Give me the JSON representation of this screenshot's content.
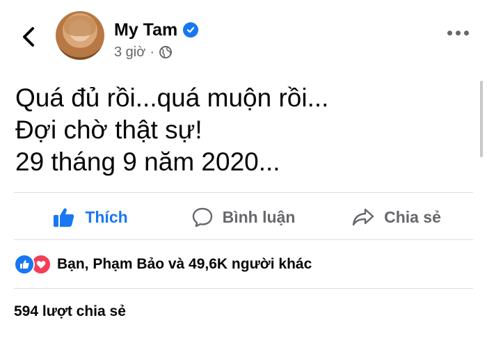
{
  "header": {
    "author_name": "My Tam",
    "time_text": "3 giờ",
    "separator": "·",
    "icons": {
      "back": "chevron-left-icon",
      "verified": "verified-check-icon",
      "audience": "globe-icon",
      "more": "more-dots-icon"
    }
  },
  "post": {
    "lines": [
      "Quá đủ rồi...quá muộn rồi...",
      "Đợi chờ thật sự!",
      "29 tháng 9 năm 2020..."
    ]
  },
  "actions": [
    {
      "label": "Thích",
      "icon": "thumbs-up-icon",
      "active": true
    },
    {
      "label": "Bình luận",
      "icon": "comment-icon",
      "active": false
    },
    {
      "label": "Chia sẻ",
      "icon": "share-icon",
      "active": false
    }
  ],
  "reactions": {
    "icons": [
      "like-reaction-icon",
      "love-reaction-icon"
    ],
    "text": "Bạn, Phạm Bảo và 49,6K người khác"
  },
  "shares_text": "594 lượt chia sẻ",
  "colors": {
    "accent": "#1877f2",
    "muted": "#65676b",
    "love": "#f33e58",
    "divider": "#dadde1"
  }
}
